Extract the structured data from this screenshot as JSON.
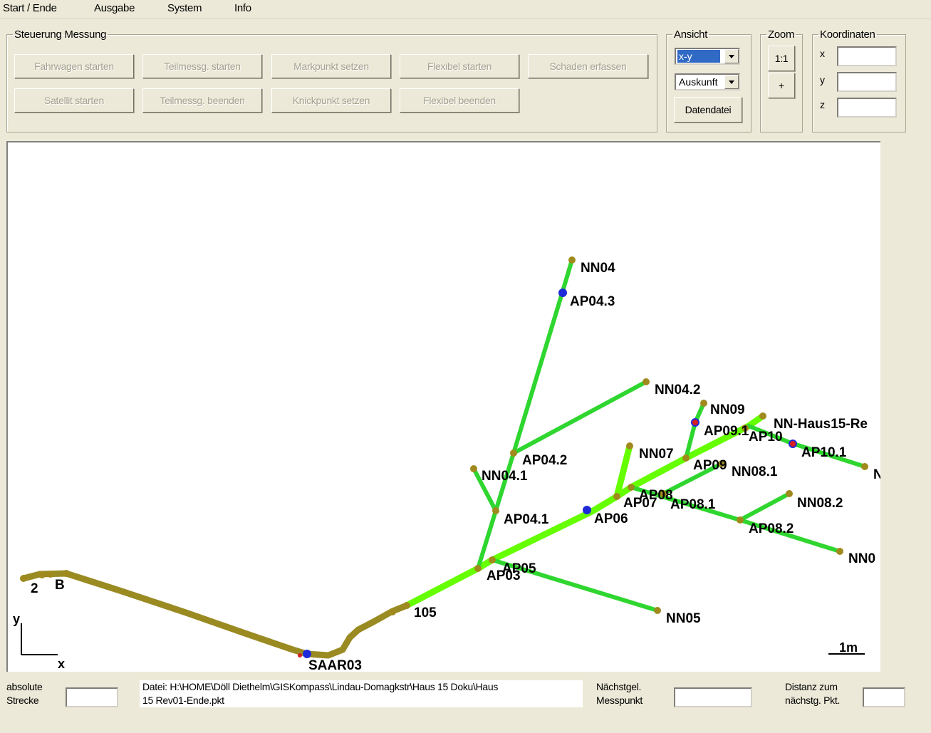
{
  "menu": [
    "Start / Ende",
    "Ausgabe",
    "System",
    "Info"
  ],
  "steuerung": {
    "legend": "Steuerung Messung",
    "row1": [
      "Fahrwagen starten",
      "Teilmessg. starten",
      "Markpunkt setzen",
      "Flexibel starten",
      "Schaden erfassen"
    ],
    "row2": [
      "Satellit starten",
      "Teilmessg. beenden",
      "Knickpunkt setzen",
      "Flexibel beenden"
    ]
  },
  "ansicht": {
    "legend": "Ansicht",
    "view_value": "x-y",
    "mode_value": "Auskunft",
    "datendatei_label": "Datendatei"
  },
  "zoom": {
    "legend": "Zoom",
    "one_to_one": "1:1",
    "plus": "+"
  },
  "koordinaten": {
    "legend": "Koordinaten",
    "x_label": "x",
    "y_label": "y",
    "z_label": "z",
    "x_value": "",
    "y_value": "",
    "z_value": ""
  },
  "canvas": {
    "axis_y": "y",
    "axis_x": "x",
    "scale_label": "1m",
    "labels": [
      "NN04",
      "AP04.3",
      "NN04.2",
      "NN09",
      "NN-Haus15-Re",
      "AP09.1",
      "AP10",
      "AP10.1",
      "N",
      "NN07",
      "AP04.2",
      "AP09",
      "NN08.1",
      "NN04.1",
      "AP08",
      "AP07",
      "AP08.1",
      "NN08.2",
      "AP06",
      "AP04.1",
      "AP08.2",
      "NN0",
      "AP05",
      "AP03",
      "105",
      "NN05",
      "2",
      "B",
      "SAAR03"
    ]
  },
  "status": {
    "absolute_label_1": "absolute",
    "absolute_label_2": "Strecke",
    "absolute_value": "",
    "file_text_1": "Datei: H:\\HOME\\Döll Diethelm\\GISKompass\\Lindau-Domagkstr\\Haus 15 Doku\\Haus",
    "file_text_2": "15 Rev01-Ende.pkt",
    "naechstgel_label_1": "Nächstgel.",
    "naechstgel_label_2": "Messpunkt",
    "naechstgel_value": "",
    "distanz_label_1": "Distanz zum",
    "distanz_label_2": "nächstg. Pkt.",
    "distanz_value": ""
  }
}
